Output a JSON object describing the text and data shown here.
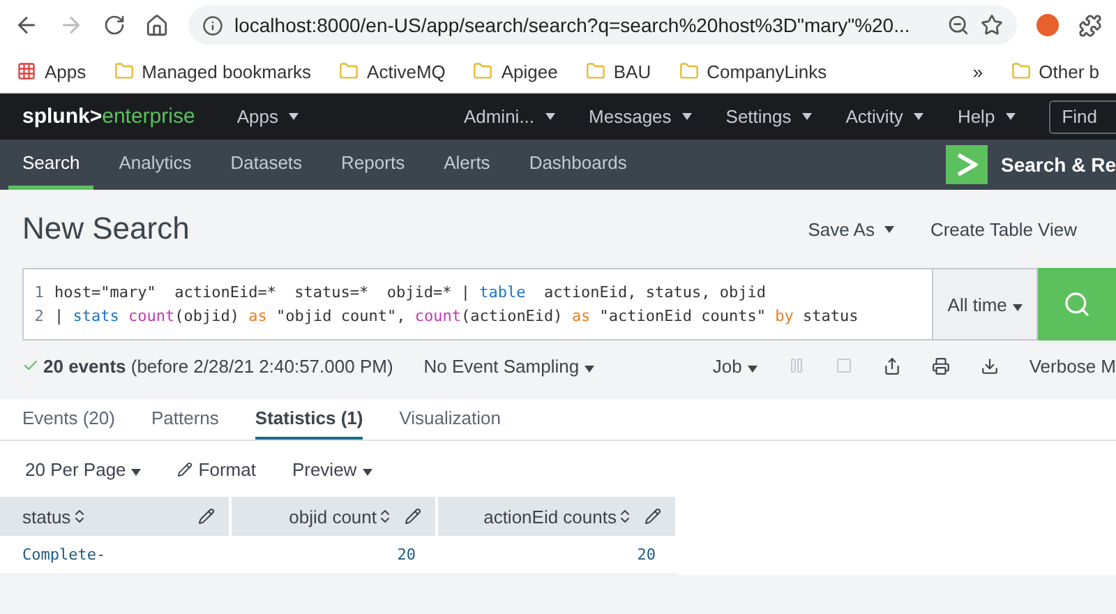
{
  "browser": {
    "url": "localhost:8000/en-US/app/search/search?q=search%20host%3D\"mary\"%20...",
    "bookmarks": [
      "Apps",
      "Managed bookmarks",
      "ActiveMQ",
      "Apigee",
      "BAU",
      "CompanyLinks"
    ],
    "more": "»",
    "other": "Other b"
  },
  "topbar": {
    "logo_brand": "splunk>",
    "logo_product": "enterprise",
    "apps": "Apps",
    "menus": [
      "Admini...",
      "Messages",
      "Settings",
      "Activity",
      "Help"
    ],
    "find_placeholder": "Find"
  },
  "appbar": {
    "tabs": [
      {
        "label": "Search",
        "selected": true
      },
      {
        "label": "Analytics",
        "selected": false
      },
      {
        "label": "Datasets",
        "selected": false
      },
      {
        "label": "Reports",
        "selected": false
      },
      {
        "label": "Alerts",
        "selected": false
      },
      {
        "label": "Dashboards",
        "selected": false
      }
    ],
    "app_name": "Search & Re"
  },
  "page": {
    "title": "New Search",
    "save_as": "Save As",
    "create_table": "Create Table View"
  },
  "query": {
    "lines": [
      [
        {
          "kind": "plain",
          "text": "host=\"mary\"  actionEid=*  status=*  objid=* | "
        },
        {
          "kind": "command",
          "text": "table"
        },
        {
          "kind": "plain",
          "text": "  actionEid, status, objid"
        }
      ],
      [
        {
          "kind": "plain",
          "text": "| "
        },
        {
          "kind": "command",
          "text": "stats"
        },
        {
          "kind": "function",
          "text": " count"
        },
        {
          "kind": "plain",
          "text": "(objid) "
        },
        {
          "kind": "keyword",
          "text": "as"
        },
        {
          "kind": "plain",
          "text": " \"objid count\", "
        },
        {
          "kind": "function",
          "text": "count"
        },
        {
          "kind": "plain",
          "text": "(actionEid) "
        },
        {
          "kind": "keyword",
          "text": "as"
        },
        {
          "kind": "plain",
          "text": " \"actionEid counts\" "
        },
        {
          "kind": "keyword",
          "text": "by"
        },
        {
          "kind": "plain",
          "text": " status"
        }
      ]
    ],
    "line_numbers": [
      "1",
      "2"
    ],
    "time_range": "All time"
  },
  "status": {
    "summary": "**20 events** (before 2/28/21 2:40:57.000 PM)",
    "sampling": "No Event Sampling",
    "job": "Job",
    "mode": "Verbose M"
  },
  "result_tabs": [
    {
      "label": "Events (20)",
      "selected": false
    },
    {
      "label": "Patterns",
      "selected": false
    },
    {
      "label": "Statistics (1)",
      "selected": true
    },
    {
      "label": "Visualization",
      "selected": false
    }
  ],
  "table_controls": {
    "per_page": "20 Per Page",
    "format": "Format",
    "preview": "Preview"
  },
  "table": {
    "columns": [
      "status",
      "objid count",
      "actionEid counts"
    ],
    "rows": [
      [
        "Complete-",
        "20",
        "20"
      ]
    ]
  }
}
